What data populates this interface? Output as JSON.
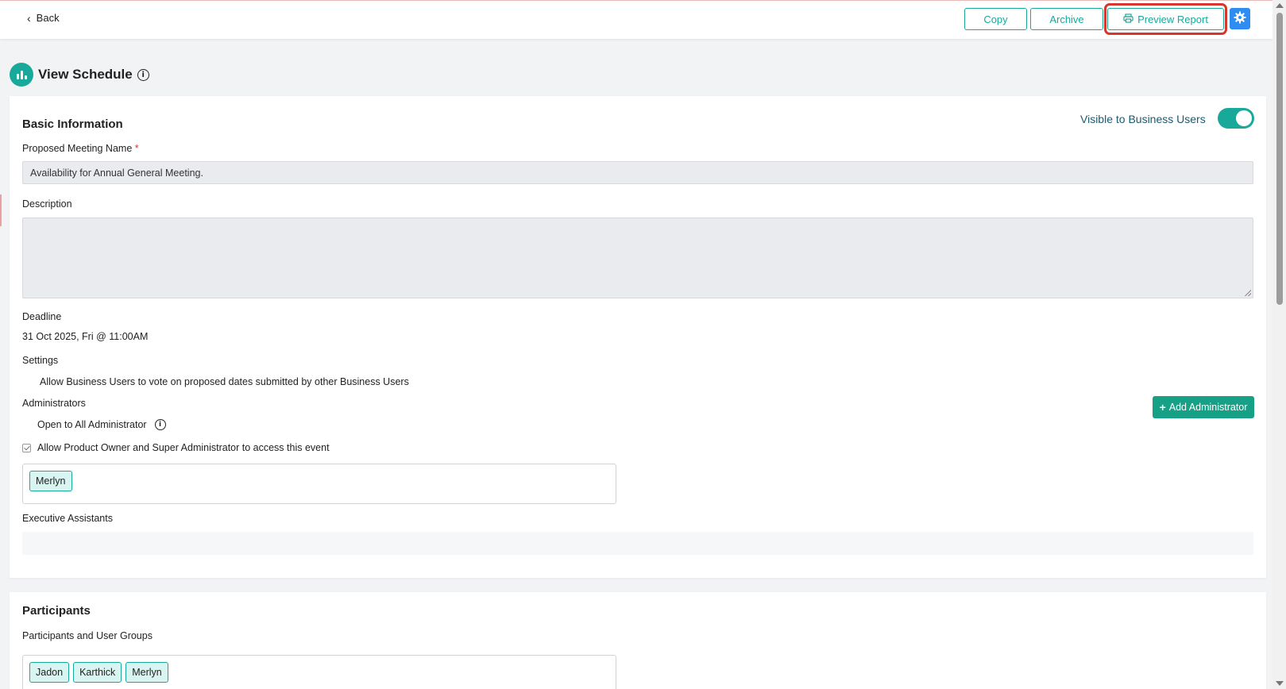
{
  "topbar": {
    "back_label": "Back",
    "copy_label": "Copy",
    "archive_label": "Archive",
    "preview_label": "Preview Report"
  },
  "page": {
    "title": "View Schedule"
  },
  "basic_info": {
    "section_title": "Basic Information",
    "visible_label": "Visible to Business Users",
    "visible_on": true,
    "meeting_name_label": "Proposed Meeting Name",
    "required_mark": "*",
    "meeting_name_value": "Availability for Annual General Meeting.",
    "description_label": "Description",
    "description_value": "",
    "deadline_label": "Deadline",
    "deadline_value": "31 Oct 2025, Fri @ 11:00AM",
    "settings_label": "Settings",
    "settings_text": "Allow Business Users to vote on proposed dates submitted by other Business Users",
    "administrators_label": "Administrators",
    "add_admin_label": "Add Administrator",
    "open_to_all_label": "Open to All Administrator",
    "allow_po_label": "Allow Product Owner and Super Administrator to access this event",
    "admin_tags": [
      "Merlyn"
    ],
    "exec_label": "Executive Assistants"
  },
  "participants": {
    "section_title": "Participants",
    "groups_label": "Participants and User Groups",
    "tags": [
      "Jadon",
      "Karthick",
      "Merlyn"
    ]
  },
  "colors": {
    "accent": "#19a99a",
    "add_button": "#16a085",
    "gear_button": "#2f8cf0",
    "highlight": "#d6362b"
  }
}
